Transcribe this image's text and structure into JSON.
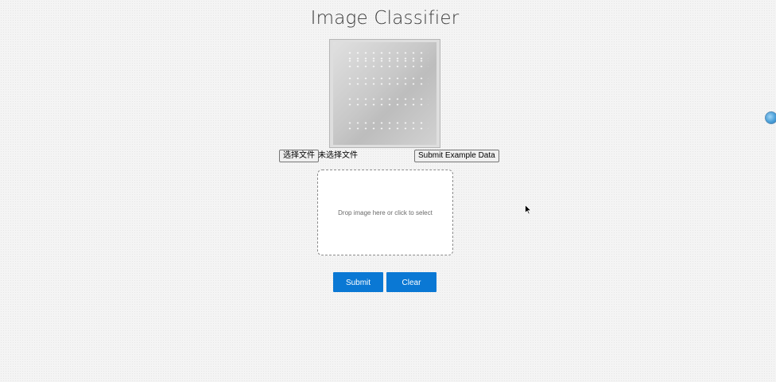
{
  "header": {
    "title": "Image Classifier"
  },
  "preview": {
    "icon": "image-preview"
  },
  "file_input": {
    "button_label": "选择文件",
    "status_text": "未选择文件"
  },
  "example": {
    "button_label": "Submit Example Data"
  },
  "dropzone": {
    "text": "Drop image here or click to select"
  },
  "actions": {
    "submit_label": "Submit",
    "clear_label": "Clear"
  },
  "colors": {
    "accent": "#0a78d4",
    "background": "#f4f4f4",
    "dropzone_border": "#8a8a8a"
  },
  "icons": {
    "cursor": "mouse-pointer-icon",
    "side": "browser-extension-icon"
  }
}
